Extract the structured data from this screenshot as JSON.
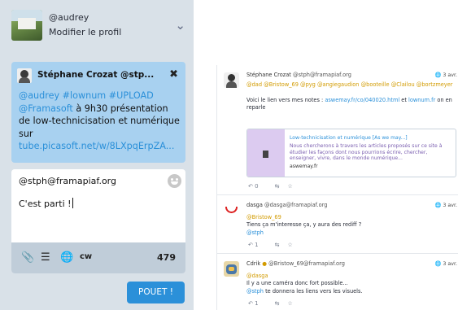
{
  "colors": {
    "accent": "#2b90d9",
    "column_bg": "#d9e1e8",
    "reply_bg": "#a8d1f0",
    "mention": "#d29b00"
  },
  "account": {
    "handle": "@audrey",
    "edit_label": "Modifier le profil",
    "menu_icon": "chevron-down-icon"
  },
  "reply": {
    "author": "Stéphane Crozat @stp...",
    "close_icon": "close-icon",
    "text": {
      "tags": "@audrey #lownum #UPLOAD",
      "org": "@Framasoft",
      "plain": " à 9h30 présentation de low-technicisation et numérique sur ",
      "link": "tube.picasoft.net/w/8LXpqErpZA..."
    }
  },
  "compose": {
    "to": "@stph@framapiaf.org",
    "body": "C'est parti !",
    "emoji_icon": "smile-icon",
    "toolbar": {
      "attach_icon": "paperclip-icon",
      "poll_icon": "poll-icon",
      "visibility_icon": "globe-icon",
      "cw": "cw",
      "count": "479"
    },
    "publish": "POUET !"
  },
  "timeline": [
    {
      "author": "Stéphane Crozat",
      "acct": "@stph@framapiaf.org",
      "time": "3 avr.",
      "mentions": "@dad @Bristow_69 @pyg @angiegaudion @booteille @Clailou @bortzmeyer",
      "body_pre": "Voici le lien vers mes notes : ",
      "link1": "aswemay.fr/co/040020.html",
      "body_mid": " et ",
      "link2": "lownum.fr",
      "body_post": " on en reparle",
      "card": {
        "title": "Low-technicisation et numérique [As we may...]",
        "description": "Nous chercherons à travers les articles proposés sur ce site à étudier les façons dont nous pourrions écrire, chercher, enseigner, vivre, dans le monde numérique...",
        "host": "aswemay.fr"
      },
      "replies": "0"
    },
    {
      "author": "dasga",
      "acct": "@dasga@framapiaf.org",
      "time": "3 avr.",
      "mention": "@Bristow_69",
      "body": "Tiens ça m'interesse ça, y aura des rediff ?",
      "mention2": "@stph",
      "replies": "1"
    },
    {
      "author": "Cdrik",
      "acct": "@Bristow_69@framapiaf.org",
      "time": "3 avr.",
      "mention": "@dasga",
      "body1": "Il y a une caméra donc fort possible...",
      "mention2": "@stph",
      "body2": " te donnera les liens vers les visuels.",
      "replies": "1"
    }
  ]
}
